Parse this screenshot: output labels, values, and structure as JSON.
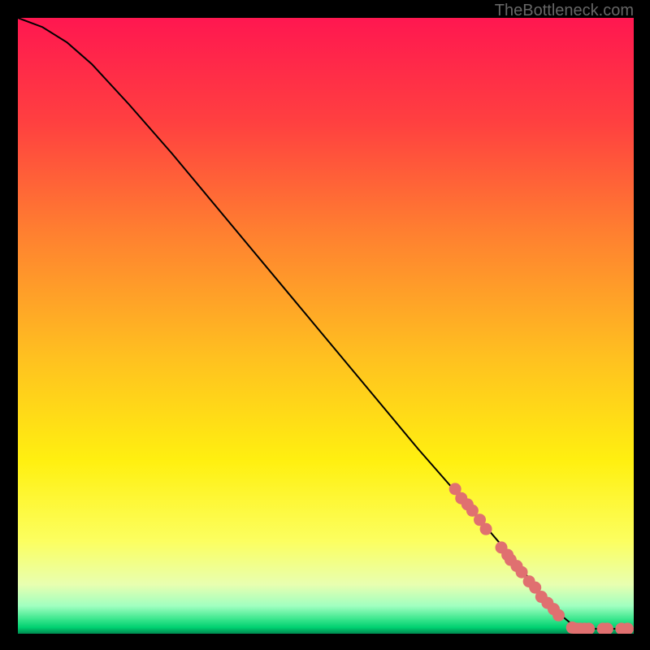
{
  "watermark": "TheBottleneck.com",
  "chart_data": {
    "type": "line",
    "title": "",
    "xlabel": "",
    "ylabel": "",
    "xlim": [
      0,
      100
    ],
    "ylim": [
      0,
      100
    ],
    "curve": {
      "description": "Decreasing curve from top-left to bottom-right, slight initial convexity then near-linear descent, flattening at bottom",
      "points": [
        {
          "x": 0,
          "y": 100
        },
        {
          "x": 4,
          "y": 98.5
        },
        {
          "x": 8,
          "y": 96
        },
        {
          "x": 12,
          "y": 92.5
        },
        {
          "x": 18,
          "y": 86
        },
        {
          "x": 25,
          "y": 78
        },
        {
          "x": 35,
          "y": 66
        },
        {
          "x": 45,
          "y": 54
        },
        {
          "x": 55,
          "y": 42
        },
        {
          "x": 65,
          "y": 30
        },
        {
          "x": 72,
          "y": 22
        },
        {
          "x": 78,
          "y": 15
        },
        {
          "x": 83,
          "y": 9
        },
        {
          "x": 87,
          "y": 4
        },
        {
          "x": 90,
          "y": 1.5
        },
        {
          "x": 93,
          "y": 0.8
        },
        {
          "x": 100,
          "y": 0.8
        }
      ]
    },
    "scatter_points": {
      "description": "Highlighted data points along the lower portion of the curve",
      "color": "#e07070",
      "points": [
        {
          "x": 71,
          "y": 23.5
        },
        {
          "x": 72,
          "y": 22
        },
        {
          "x": 73,
          "y": 21
        },
        {
          "x": 73.8,
          "y": 20
        },
        {
          "x": 75,
          "y": 18.5
        },
        {
          "x": 76,
          "y": 17
        },
        {
          "x": 78.5,
          "y": 14
        },
        {
          "x": 79.5,
          "y": 12.8
        },
        {
          "x": 80,
          "y": 12
        },
        {
          "x": 81,
          "y": 11
        },
        {
          "x": 81.8,
          "y": 10
        },
        {
          "x": 83,
          "y": 8.5
        },
        {
          "x": 84,
          "y": 7.5
        },
        {
          "x": 85,
          "y": 6
        },
        {
          "x": 86,
          "y": 5
        },
        {
          "x": 87,
          "y": 4
        },
        {
          "x": 87.8,
          "y": 3
        },
        {
          "x": 90,
          "y": 1
        },
        {
          "x": 90.7,
          "y": 0.8
        },
        {
          "x": 91.3,
          "y": 0.8
        },
        {
          "x": 92,
          "y": 0.8
        },
        {
          "x": 92.7,
          "y": 0.8
        },
        {
          "x": 95,
          "y": 0.8
        },
        {
          "x": 95.7,
          "y": 0.8
        },
        {
          "x": 98,
          "y": 0.8
        },
        {
          "x": 99,
          "y": 0.8
        }
      ]
    },
    "gradient_stops": [
      {
        "offset": 0,
        "color": "#ff1750"
      },
      {
        "offset": 17,
        "color": "#ff4040"
      },
      {
        "offset": 35,
        "color": "#ff8030"
      },
      {
        "offset": 55,
        "color": "#ffc020"
      },
      {
        "offset": 72,
        "color": "#fff010"
      },
      {
        "offset": 85,
        "color": "#fcff60"
      },
      {
        "offset": 92,
        "color": "#e8ffb0"
      },
      {
        "offset": 95.5,
        "color": "#a0ffc0"
      },
      {
        "offset": 97.5,
        "color": "#40e890"
      },
      {
        "offset": 99,
        "color": "#00d070"
      },
      {
        "offset": 100,
        "color": "#008850"
      }
    ]
  }
}
